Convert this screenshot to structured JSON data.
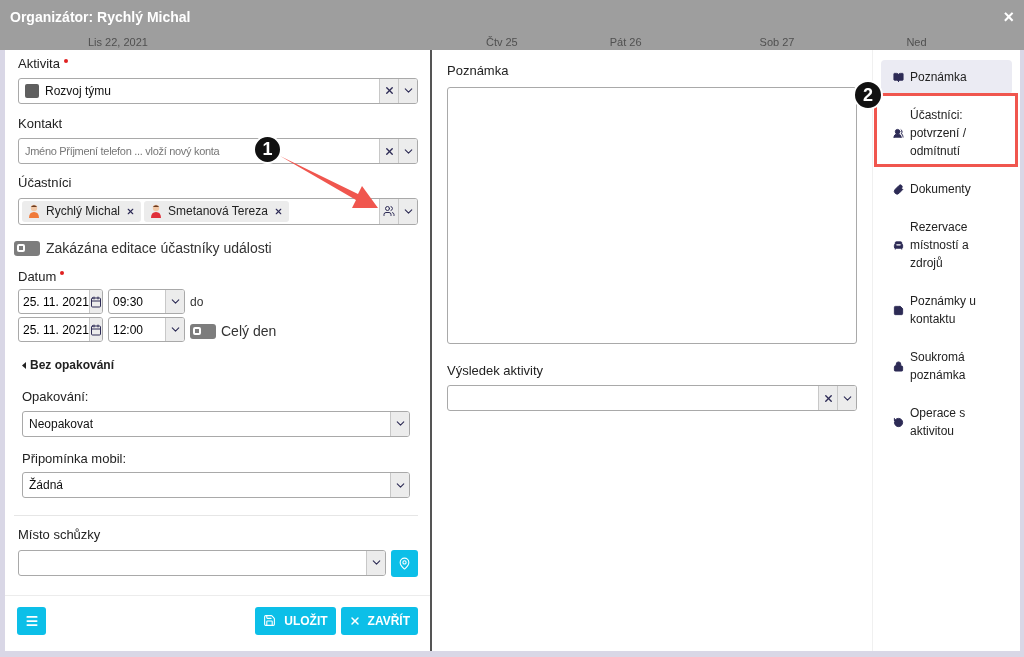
{
  "window": {
    "title": "Organizátor: Rychlý Michal",
    "close": "×"
  },
  "calendar_header": [
    "Lis 22, 2021",
    "Čtv 25",
    "Pát 26",
    "Sob 27",
    "Ned"
  ],
  "activity": {
    "label": "Aktivita",
    "required": true,
    "value": "Rozvoj týmu",
    "color": "#5f5f5f"
  },
  "contact": {
    "label": "Kontakt",
    "placeholder": "Jméno Příjmení telefon ... vloží nový konta"
  },
  "participants": {
    "label": "Účastníci",
    "chips": [
      {
        "name": "Rychlý Michal",
        "color": "#f07a3a"
      },
      {
        "name": "Smetanová Tereza",
        "color": "#e0303a"
      }
    ]
  },
  "edit_lock": {
    "label": "Zakázána editace účastníky události",
    "on": false
  },
  "date": {
    "label": "Datum",
    "required": true,
    "from": {
      "date": "25. 11. 2021",
      "time": "09:30"
    },
    "to_label": "do",
    "to": {
      "date": "25. 11. 2021",
      "time": "12:00"
    },
    "all_day": {
      "label": "Celý den",
      "on": false
    }
  },
  "recurrence": {
    "label": "Bez opakování",
    "repeat": {
      "label": "Opakování:",
      "value": "Neopakovat"
    },
    "reminder": {
      "label": "Připomínka mobil:",
      "value": "Žádná"
    }
  },
  "place": {
    "label": "Místo schůzky"
  },
  "footer": {
    "save": "ULOŽIT",
    "close": "ZAVŘÍT"
  },
  "note": {
    "label": "Poznámka"
  },
  "result": {
    "label": "Výsledek aktivity"
  },
  "sidebar": [
    {
      "label": "Poznámka",
      "selected": true
    },
    {
      "label": "Účastníci: potvrzení / odmítnutí",
      "selected": false
    },
    {
      "label": "Dokumenty",
      "selected": false
    },
    {
      "label": "Rezervace místností a zdrojů",
      "selected": false
    },
    {
      "label": "Poznámky u kontaktu",
      "selected": false
    },
    {
      "label": "Soukromá poznámka",
      "selected": false
    },
    {
      "label": "Operace s aktivitou",
      "selected": false
    }
  ],
  "annotations": [
    {
      "number": "1"
    },
    {
      "number": "2"
    }
  ]
}
